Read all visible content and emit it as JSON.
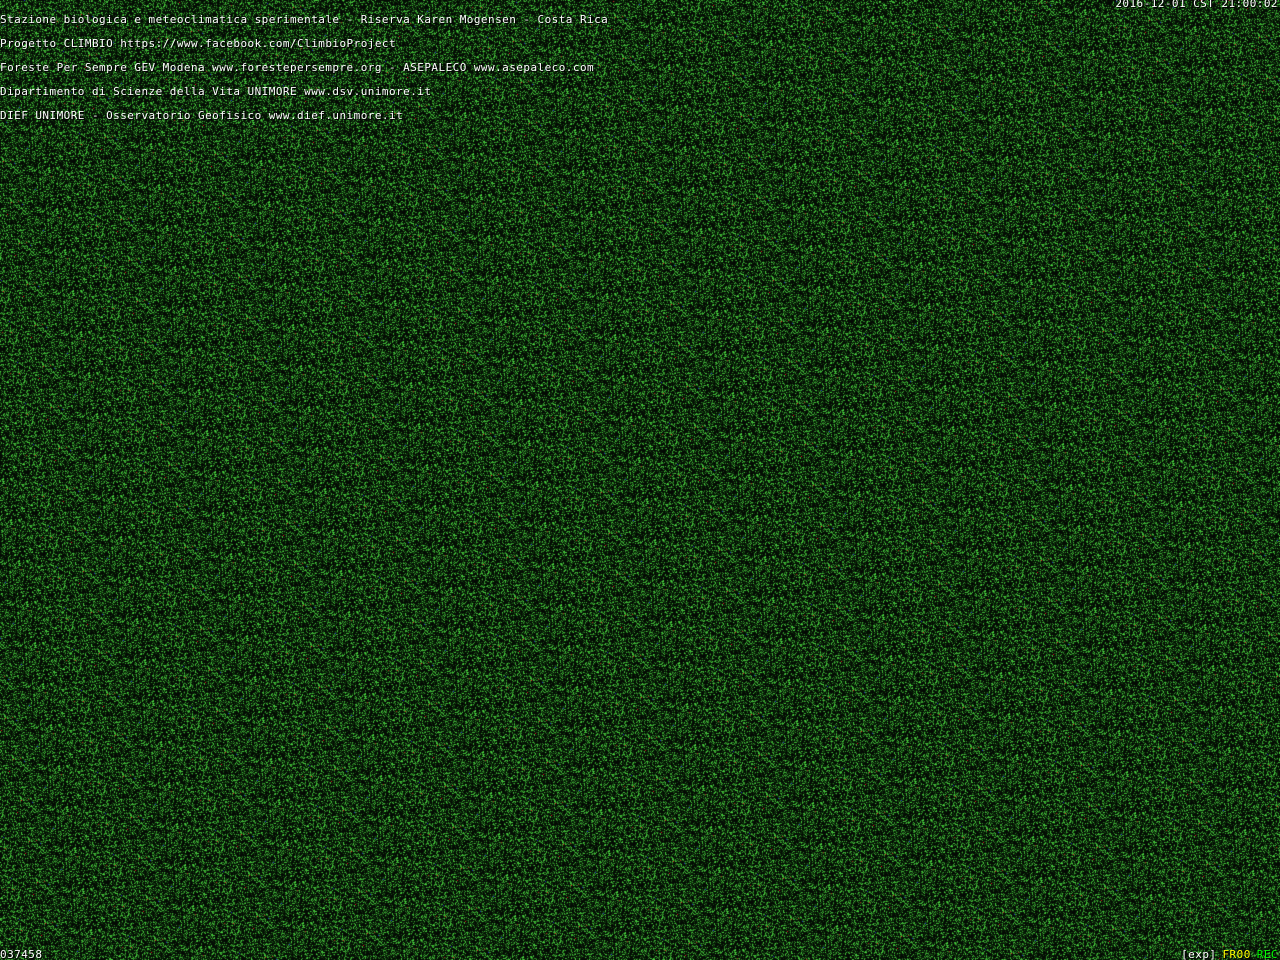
{
  "camera_overlay": {
    "header_lines": [
      "Stazione biologica e meteoclimatica sperimentale - Riserva Karen Mogensen - Costa Rica",
      "Progetto CLIMBIO https://www.facebook.com/ClimbioProject",
      "Foreste Per Sempre GEV Modena www.forestepersempre.org - ASEPALECO www.asepaleco.com",
      "Dipartimento di Scienze della Vita UNIMORE www.dsv.unimore.it",
      "DIEF UNIMORE - Osservatorio Geofisico www.dief.unimore.it"
    ],
    "timestamp": "2016-12-01 CST 21:00:02",
    "frame_counter": "037458",
    "status": {
      "exposure": "[exp]",
      "frame_rate": "FR00",
      "recording": "REC"
    }
  },
  "colors": {
    "text": "#ffffff",
    "noise_green": "#4fd04a",
    "noise_red": "#c03030",
    "noise_blue": "#3040c0",
    "frame_rate": "#ffff00",
    "recording": "#00ff00"
  }
}
